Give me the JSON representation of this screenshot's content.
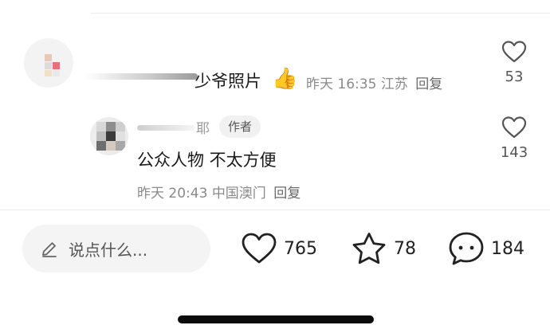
{
  "comments": [
    {
      "text": "少爷照片",
      "emoji": "👍",
      "time": "昨天 16:35",
      "location": "江苏",
      "reply_label": "回复",
      "likes": "53"
    },
    {
      "name_visible": "耶",
      "badge": "作者",
      "text": "公众人物 不太方便",
      "time": "昨天 20:43",
      "location": "中国澳门",
      "reply_label": "回复",
      "likes": "143"
    }
  ],
  "bottom_bar": {
    "input_placeholder": "说点什么...",
    "like_count": "765",
    "favorite_count": "78",
    "comment_count": "184"
  },
  "colors": {
    "text_primary": "#1a1a1a",
    "text_meta": "#8a8a8a",
    "badge_bg": "#f1f1f1",
    "input_bg": "#f4f4f4"
  },
  "icons": [
    "heart-icon",
    "heart-icon",
    "pencil-icon",
    "heart-icon",
    "star-icon",
    "chat-bubble-icon"
  ]
}
